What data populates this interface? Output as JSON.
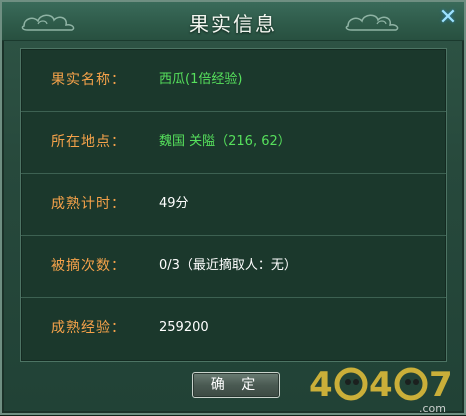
{
  "dialog": {
    "title": "果实信息",
    "close_icon": "close-icon"
  },
  "fields": [
    {
      "label": "果实名称：",
      "value": "西瓜(1倍经验)",
      "color": "#56e05c"
    },
    {
      "label": "所在地点：",
      "value": "魏国 关隘（216, 62）",
      "color": "#56e05c"
    },
    {
      "label": "成熟计时：",
      "value": "49分",
      "color": "#ffffff"
    },
    {
      "label": "被摘次数：",
      "value": "0/3（最近摘取人：无）",
      "color": "#ffffff"
    },
    {
      "label": "成熟经验：",
      "value": "259200",
      "color": "#ffffff"
    }
  ],
  "buttons": {
    "confirm_label": "确 定"
  },
  "watermark": {
    "text": "4047",
    "suffix": ".com"
  },
  "colors": {
    "label": "#f5a24a",
    "accent_green": "#56e05c",
    "panel": "#1b382c"
  }
}
